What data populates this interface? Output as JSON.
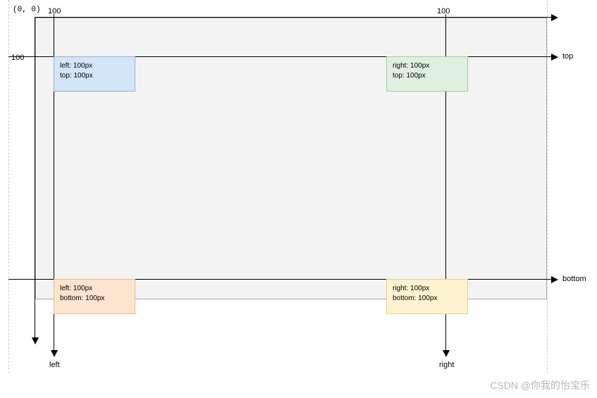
{
  "origin": "(0, 0)",
  "ticks": {
    "top_left": "100",
    "top_right": "100",
    "left_side": "100"
  },
  "axis_labels": {
    "top": "top",
    "bottom": "bottom",
    "left": "left",
    "right": "right"
  },
  "boxes": {
    "blue": {
      "line1": "left: 100px",
      "line2": "top: 100px"
    },
    "green": {
      "line1": "right: 100px",
      "line2": "top: 100px"
    },
    "orange": {
      "line1": "left: 100px",
      "line2": "bottom: 100px"
    },
    "yellow": {
      "line1": "right: 100px",
      "line2": "bottom: 100px"
    }
  },
  "watermark": "CSDN @你我的怡宝乐"
}
